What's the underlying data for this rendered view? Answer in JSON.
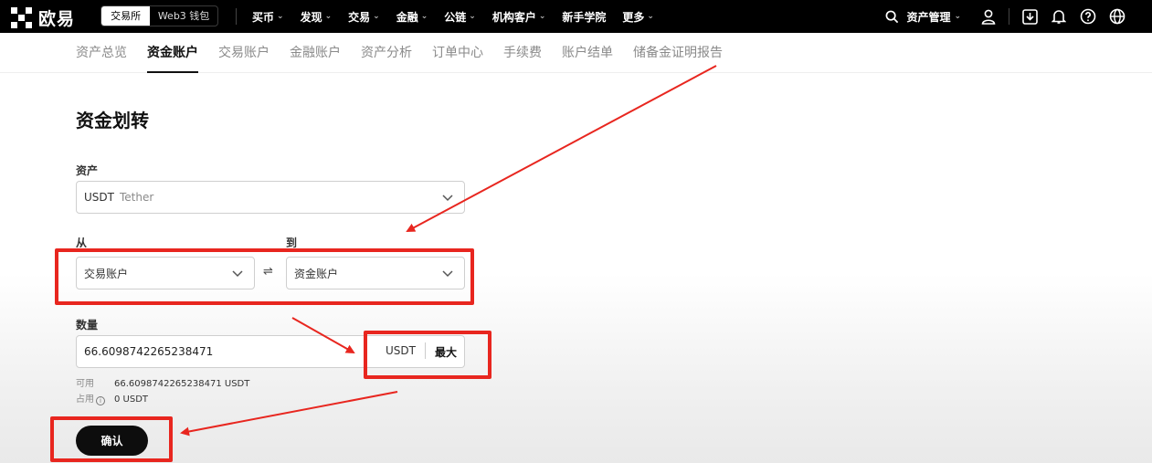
{
  "header": {
    "logo_text": "欧易",
    "segment": {
      "active": "交易所",
      "inactive": "Web3 钱包"
    },
    "nav": [
      "买币",
      "发现",
      "交易",
      "金融",
      "公链",
      "机构客户",
      "新手学院",
      "更多"
    ],
    "nav_has_chevron": [
      true,
      true,
      true,
      true,
      true,
      true,
      false,
      true
    ],
    "asset_management": "资产管理"
  },
  "subnav": {
    "items": [
      "资产总览",
      "资金账户",
      "交易账户",
      "金融账户",
      "资产分析",
      "订单中心",
      "手续费",
      "账户结单",
      "储备金证明报告"
    ],
    "active_index": 1
  },
  "form": {
    "title": "资金划转",
    "asset_label": "资产",
    "asset_value": "USDT",
    "asset_sub": "Tether",
    "from_label": "从",
    "from_value": "交易账户",
    "to_label": "到",
    "to_value": "资金账户",
    "swap_symbol": "⇌",
    "quantity_label": "数量",
    "quantity_value": "66.6098742265238471",
    "quantity_unit": "USDT",
    "max_label": "最大",
    "available_label": "可用",
    "available_value": "66.6098742265238471 USDT",
    "occupied_label": "占用",
    "occupied_value": "0 USDT",
    "confirm_label": "确认"
  },
  "colors": {
    "annotation_red": "#e8261f",
    "primary": "#0d0d0d"
  }
}
